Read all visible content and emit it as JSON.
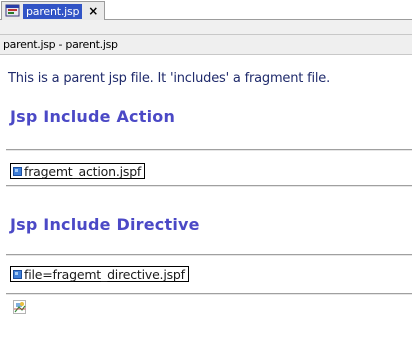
{
  "tab": {
    "label": "parent.jsp",
    "close_label": "×",
    "icon": "jsp-file-icon"
  },
  "breadcrumb": {
    "text": "parent.jsp - parent.jsp"
  },
  "canvas": {
    "intro_text": "This is a parent jsp file. It 'includes' a fragment file.",
    "heading_action": "Jsp Include Action",
    "include_action_text": "fragemt_action.jspf",
    "heading_directive": "Jsp Include Directive",
    "include_directive_text": "file=fragemt_directive.jspf",
    "broken_image_icon": "broken-image-icon"
  },
  "colors": {
    "tab_selected_bg": "#3154c6",
    "heading": "#4b49c6",
    "fragment_icon": "#3f7fd9"
  }
}
